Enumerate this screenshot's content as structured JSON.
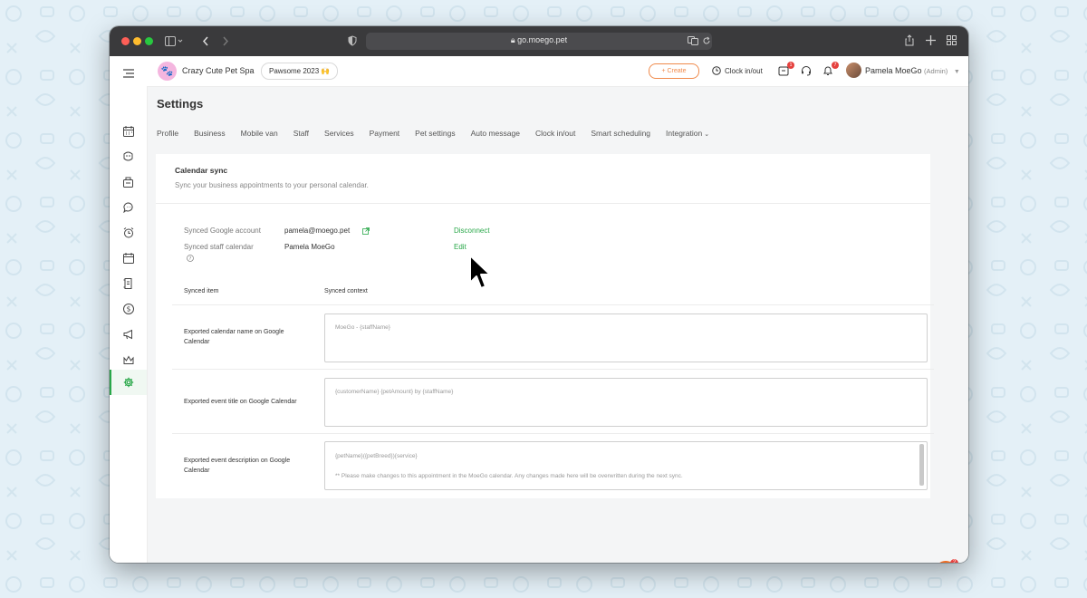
{
  "browser": {
    "url": "go.moego.pet"
  },
  "business": {
    "name": "Crazy Cute Pet Spa",
    "pill": "Pawsome 2023 🙌"
  },
  "topbar": {
    "create_label": "+ Create",
    "clock_label": "Clock in/out",
    "inbox_badge": "1",
    "notifications_badge": "7",
    "user_name": "Pamela MoeGo",
    "user_role": "(Admin)"
  },
  "page": {
    "title": "Settings"
  },
  "tabs": [
    "Profile",
    "Business",
    "Mobile van",
    "Staff",
    "Services",
    "Payment",
    "Pet settings",
    "Auto message",
    "Clock in/out",
    "Smart scheduling",
    "Integration"
  ],
  "calendar_sync": {
    "title": "Calendar sync",
    "subtitle": "Sync your business appointments to your personal calendar.",
    "google_account_label": "Synced Google account",
    "google_account_value": "pamela@moego.pet",
    "disconnect_label": "Disconnect",
    "staff_calendar_label": "Synced staff calendar",
    "staff_calendar_value": "Pamela MoeGo",
    "edit_label": "Edit",
    "col_item": "Synced item",
    "col_context": "Synced context",
    "rows": [
      {
        "label": "Exported calendar name on Google Calendar",
        "text": "MoeGo - {staffName}",
        "text2": ""
      },
      {
        "label": "Exported event title on Google Calendar",
        "text": "{customerName} {petAmount} by {staffName}",
        "text2": ""
      },
      {
        "label": "Exported event description on Google Calendar",
        "text": "{petName}({petBreed}){service}",
        "text2": "** Please make changes to this appointment in the MoeGo calendar. Any changes made here will be overwritten during the next sync."
      }
    ]
  },
  "chat": {
    "badge": "2"
  },
  "colors": {
    "accent_green": "#2aa84a",
    "create_orange": "#f08a4b",
    "badge_red": "#e5413e",
    "chat_orange": "#f06a1e"
  }
}
